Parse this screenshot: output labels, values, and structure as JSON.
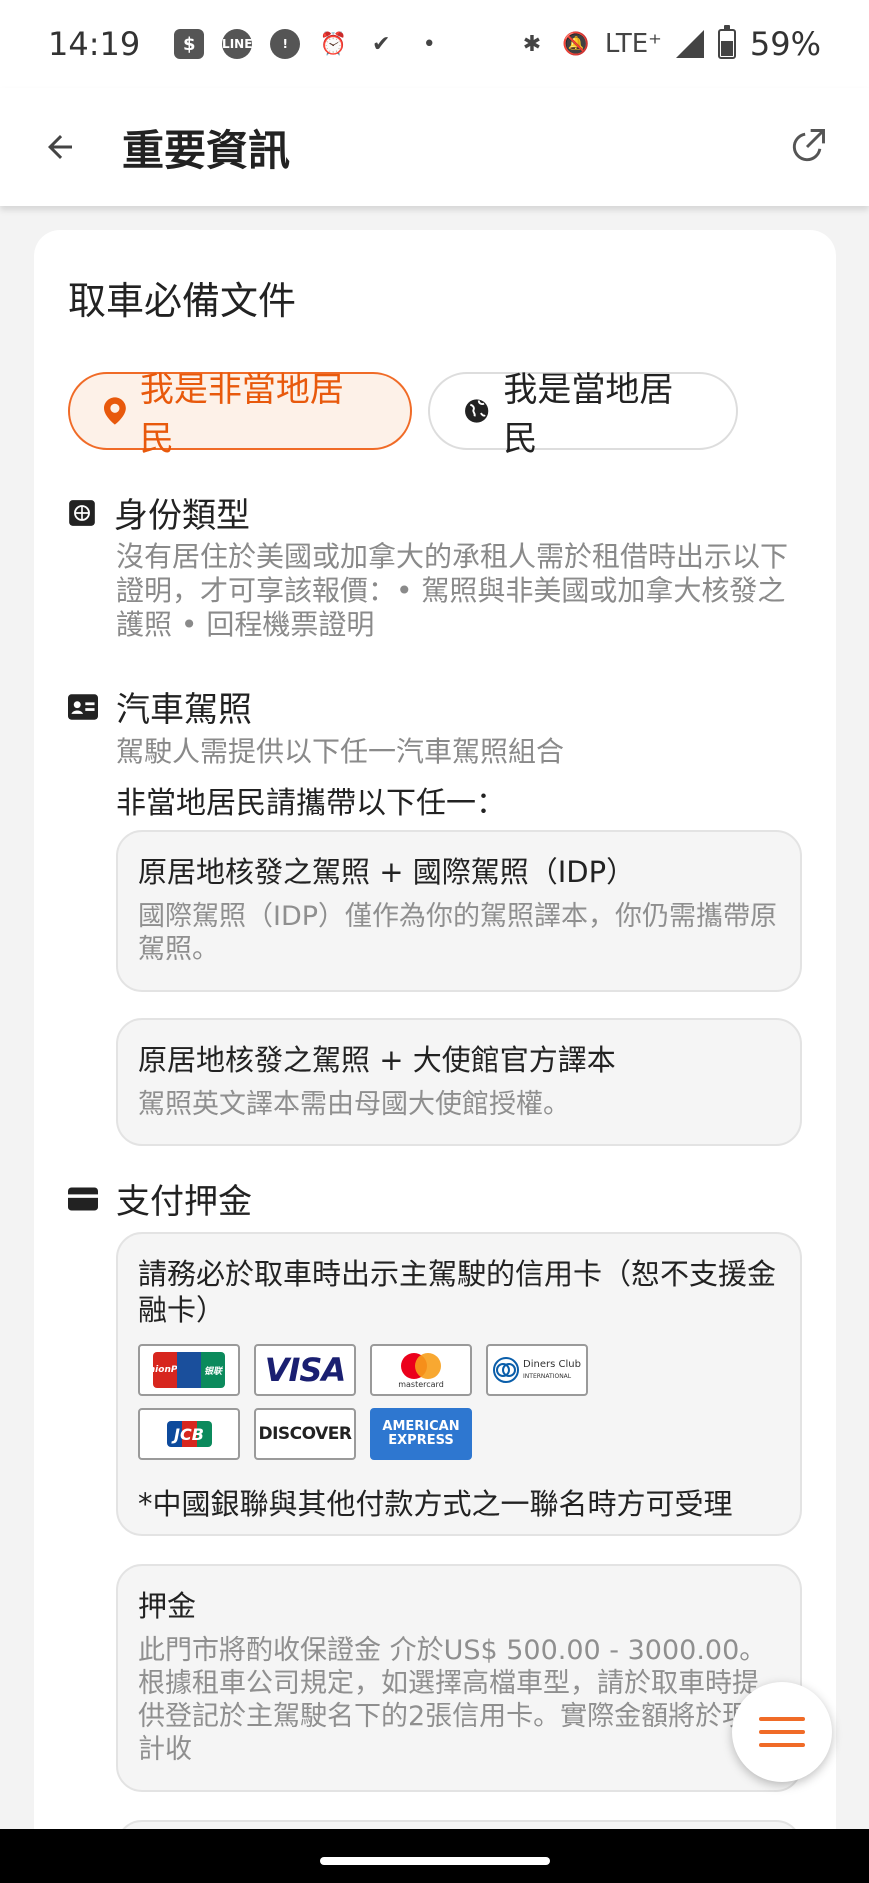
{
  "status_bar": {
    "time": "14:19",
    "network": "LTE⁺",
    "battery": "59%",
    "battery_level": 0.59,
    "icons": [
      "s-icon",
      "line-icon",
      "alert-icon",
      "alarm-icon",
      "check-icon",
      "dot-icon",
      "bluetooth-icon",
      "mute-icon",
      "signal-icon",
      "battery-icon"
    ]
  },
  "header": {
    "title": "重要資訊",
    "back_icon": "arrow-left-icon",
    "share_icon": "external-link-icon"
  },
  "section": {
    "title": "取車必備文件",
    "chips": [
      {
        "label": "我是非當地居民",
        "selected": true,
        "icon": "location-pin-icon"
      },
      {
        "label": "我是當地居民",
        "selected": false,
        "icon": "globe-icon"
      }
    ]
  },
  "identity": {
    "title": "身份類型",
    "description": "沒有居住於美國或加拿大的承租人需於租借時出示以下證明，才可享該報價：• 駕照與非美國或加拿大核發之護照 • 回程機票證明"
  },
  "license": {
    "title": "汽車駕照",
    "description": "駕駛人需提供以下任一汽車駕照組合",
    "note": "非當地居民請攜帶以下任一：",
    "options": [
      {
        "title": "原居地核發之駕照 + 國際駕照（IDP）",
        "description": "國際駕照（IDP）僅作為你的駕照譯本，你仍需攜帶原駕照。"
      },
      {
        "title": "原居地核發之駕照 + 大使館官方譯本",
        "description": "駕照英文譯本需由母國大使館授權。"
      }
    ]
  },
  "payment": {
    "title": "支付押金",
    "credit_card": {
      "title": "請務必於取車時出示主駕駛的信用卡（恕不支援金融卡）",
      "cards": {
        "unionpay_top": "UnionPay",
        "unionpay_bottom": "银联",
        "visa": "VISA",
        "mastercard": "mastercard",
        "diners_top": "Diners Club",
        "diners_bottom": "INTERNATIONAL",
        "jcb": "JCB",
        "discover": "DISCOVER",
        "amex_top": "AMERICAN",
        "amex_bottom": "EXPRESS"
      },
      "note": "*中國銀聯與其他付款方式之一聯名時方可受理"
    },
    "deposit": {
      "title": "押金",
      "description": "此門市將酌收保證金 介於US$ 500.00 - 3000.00。根據租車公司規定，如選擇高檔車型，請於取車時提供登記於主駕駛名下的2張信用卡。實際金額將於現場計收"
    }
  },
  "fab": {
    "icon": "menu-icon"
  },
  "colors": {
    "accent": "#f06b27",
    "accent_bg": "#fdf1e8",
    "muted_text": "#8a8a8a"
  }
}
